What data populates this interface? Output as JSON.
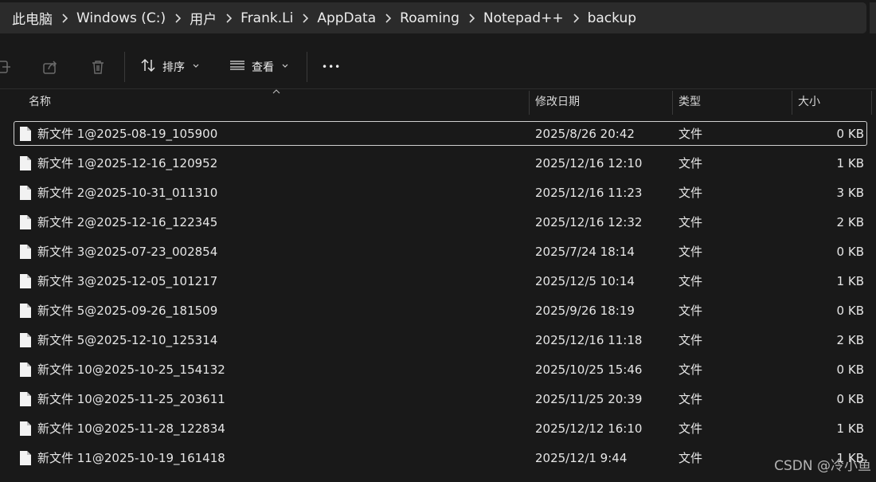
{
  "breadcrumb": [
    "此电脑",
    "Windows (C:)",
    "用户",
    "Frank.Li",
    "AppData",
    "Roaming",
    "Notepad++",
    "backup"
  ],
  "toolbar": {
    "icons": [
      "share-link-icon",
      "share-icon",
      "delete-icon"
    ],
    "sort_label": "排序",
    "view_label": "查看",
    "more_label": "•••"
  },
  "columns": {
    "name": "名称",
    "modified": "修改日期",
    "type": "类型",
    "size": "大小"
  },
  "files": [
    {
      "name": "新文件 1@2025-08-19_105900",
      "modified": "2025/8/26 20:42",
      "type": "文件",
      "size": "0 KB",
      "selected": true
    },
    {
      "name": "新文件 1@2025-12-16_120952",
      "modified": "2025/12/16 12:10",
      "type": "文件",
      "size": "1 KB"
    },
    {
      "name": "新文件 2@2025-10-31_011310",
      "modified": "2025/12/16 11:23",
      "type": "文件",
      "size": "3 KB"
    },
    {
      "name": "新文件 2@2025-12-16_122345",
      "modified": "2025/12/16 12:32",
      "type": "文件",
      "size": "2 KB"
    },
    {
      "name": "新文件 3@2025-07-23_002854",
      "modified": "2025/7/24 18:14",
      "type": "文件",
      "size": "0 KB"
    },
    {
      "name": "新文件 3@2025-12-05_101217",
      "modified": "2025/12/5 10:14",
      "type": "文件",
      "size": "1 KB"
    },
    {
      "name": "新文件 5@2025-09-26_181509",
      "modified": "2025/9/26 18:19",
      "type": "文件",
      "size": "0 KB"
    },
    {
      "name": "新文件 5@2025-12-10_125314",
      "modified": "2025/12/16 11:18",
      "type": "文件",
      "size": "2 KB"
    },
    {
      "name": "新文件 10@2025-10-25_154132",
      "modified": "2025/10/25 15:46",
      "type": "文件",
      "size": "0 KB"
    },
    {
      "name": "新文件 10@2025-11-25_203611",
      "modified": "2025/11/25 20:39",
      "type": "文件",
      "size": "0 KB"
    },
    {
      "name": "新文件 10@2025-11-28_122834",
      "modified": "2025/12/12 16:10",
      "type": "文件",
      "size": "1 KB"
    },
    {
      "name": "新文件 11@2025-10-19_161418",
      "modified": "2025/12/1 9:44",
      "type": "文件",
      "size": "1 KB"
    }
  ],
  "watermark": "CSDN @冷小鱼"
}
